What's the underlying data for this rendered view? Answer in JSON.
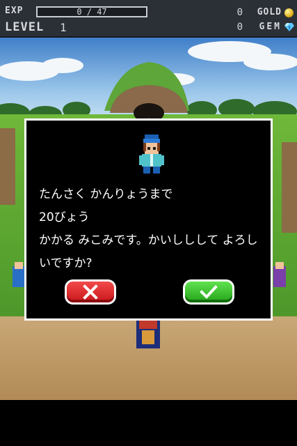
{
  "hud": {
    "exp_label": "EXP",
    "exp_value": "0 / 47",
    "exp_progress": 0,
    "level_label": "LEVEL",
    "level_value": "1",
    "gold_count": "0",
    "gold_label": "GOLD",
    "gem_count": "0",
    "gem_label": "GEM"
  },
  "dialog": {
    "lines": [
      "たんさく かんりょうまで",
      "20びょう",
      "かかる みこみです。かいししして よろし",
      "いですか?"
    ],
    "cancel_icon": "cross-icon",
    "confirm_icon": "check-icon"
  },
  "colors": {
    "cancel_button": "#e0262a",
    "confirm_button": "#3cc72f",
    "exp_bar_fill": "#4aa3ff",
    "gold": "#e2b21a",
    "gem": "#5ec8ff"
  }
}
